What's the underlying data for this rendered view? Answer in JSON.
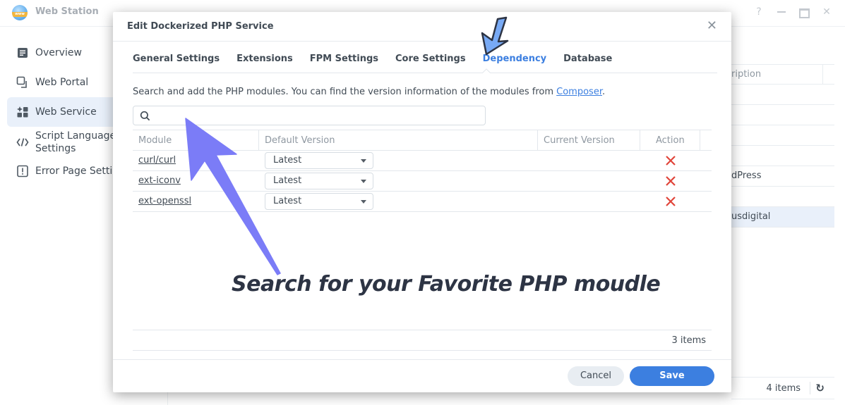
{
  "app": {
    "title": "Web Station",
    "logo_text": "www",
    "window_controls": [
      "help-icon",
      "minimize-icon",
      "maximize-icon",
      "close-icon"
    ]
  },
  "sidebar": {
    "items": [
      {
        "label": "Overview",
        "icon": "overview-icon",
        "active": false
      },
      {
        "label": "Web Portal",
        "icon": "web-portal-icon",
        "active": false
      },
      {
        "label": "Web Service",
        "icon": "web-service-icon",
        "active": true
      },
      {
        "label": "Script Language Settings",
        "label_line1": "Script Language",
        "label_line2": "Settings",
        "icon": "code-icon",
        "active": false
      },
      {
        "label": "Error Page Setti",
        "icon": "error-page-icon",
        "active": false
      }
    ]
  },
  "background_table": {
    "header": "ription",
    "rows": [
      "",
      "",
      "",
      "",
      "dPress",
      "",
      "usdigital"
    ],
    "selected_row": 6,
    "count": "4 items",
    "refresh_icon": "refresh-icon"
  },
  "dialog": {
    "title": "Edit Dockerized PHP Service",
    "close_icon": "close-icon",
    "tabs": [
      {
        "label": "General Settings",
        "active": false
      },
      {
        "label": "Extensions",
        "active": false
      },
      {
        "label": "FPM Settings",
        "active": false
      },
      {
        "label": "Core Settings",
        "active": false
      },
      {
        "label": "Dependency",
        "active": true
      },
      {
        "label": "Database",
        "active": false
      }
    ],
    "description_prefix": "Search and add the PHP modules. You can find the version information of the modules from ",
    "description_link": "Composer",
    "description_suffix": ".",
    "search": {
      "value": "",
      "placeholder": ""
    },
    "table": {
      "columns": [
        "Module",
        "Default Version",
        "Current Version",
        "Action"
      ],
      "rows": [
        {
          "module": "curl/curl",
          "default_version": "Latest",
          "current_version": ""
        },
        {
          "module": "ext-iconv",
          "default_version": "Latest",
          "current_version": ""
        },
        {
          "module": "ext-openssl",
          "default_version": "Latest",
          "current_version": ""
        }
      ],
      "count": "3 items"
    },
    "buttons": {
      "cancel": "Cancel",
      "save": "Save"
    },
    "colors": {
      "accent": "#3c7fe0",
      "delete": "#e0453a"
    }
  },
  "annotation": {
    "caption": "Search for your Favorite PHP moudle",
    "arrow_color": "#7b7cf7",
    "tab_arrow_color": "#78aaf5"
  }
}
